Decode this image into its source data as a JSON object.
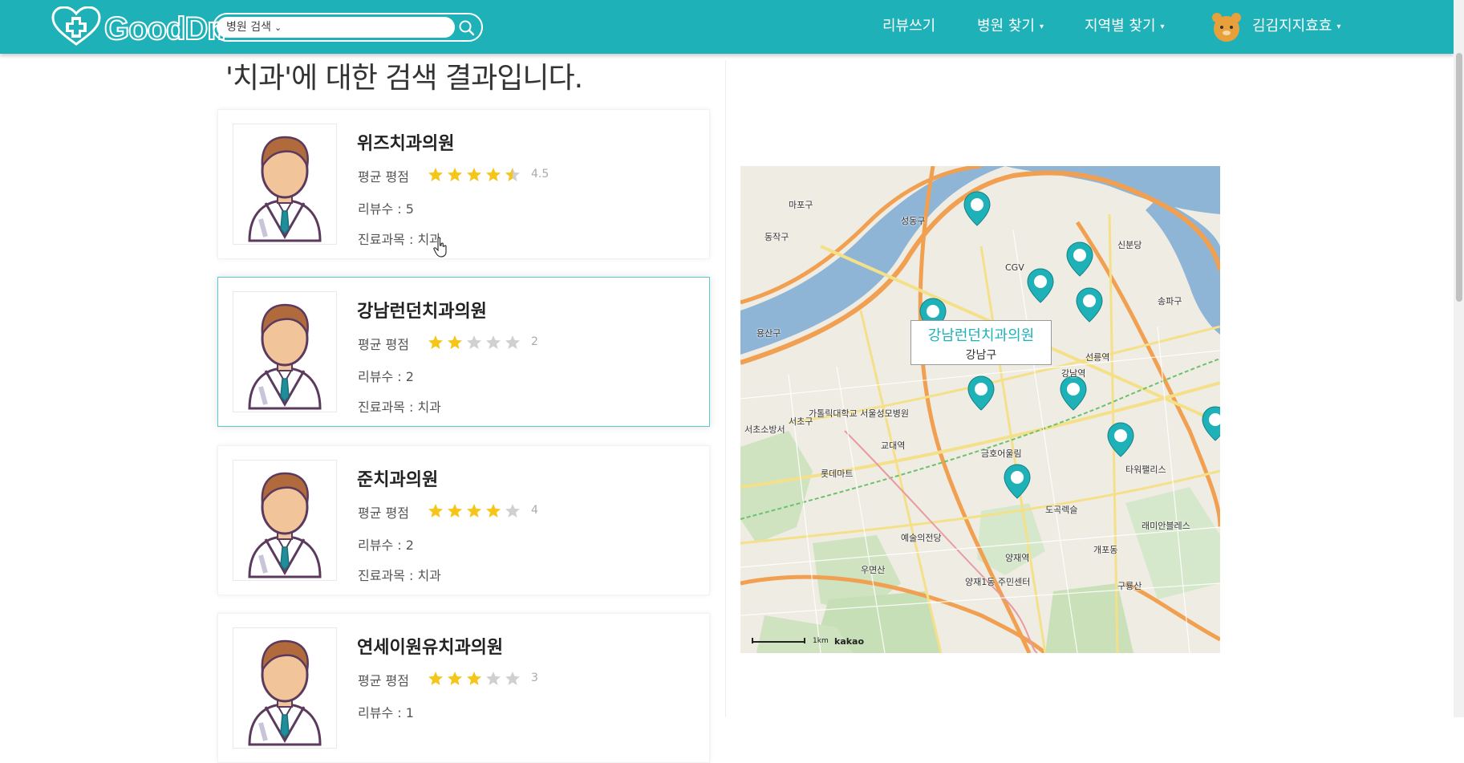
{
  "nav": {
    "logo_text": "GoodDr.",
    "search_select": "병원 검색",
    "write_review": "리뷰쓰기",
    "find_hospital": "병원 찾기",
    "find_region": "지역별 찾기",
    "user_name": "김김지지효효"
  },
  "heading": "'치과'에 대한 검색 결과입니다.",
  "labels": {
    "rating": "평균 평점",
    "reviews": "리뷰수 : ",
    "dept": "진료과목 : "
  },
  "hospitals": [
    {
      "name": "위즈치과의원",
      "rating": 4.5,
      "rating_text": "4.5",
      "reviews": "리뷰수 : 5",
      "dept": "진료과목 : 치과"
    },
    {
      "name": "강남런던치과의원",
      "rating": 2,
      "rating_text": "2",
      "reviews": "리뷰수 : 2",
      "dept": "진료과목 : 치과"
    },
    {
      "name": "준치과의원",
      "rating": 4,
      "rating_text": "4",
      "reviews": "리뷰수 : 2",
      "dept": "진료과목 : 치과"
    },
    {
      "name": "연세이원유치과의원",
      "rating": 3,
      "rating_text": "3",
      "reviews": "리뷰수 : 1",
      "dept": ""
    }
  ],
  "map": {
    "tooltip_title": "강남런던치과의원",
    "tooltip_sub": "강남구",
    "attribution": "kakao",
    "scale_label": "1km",
    "places": [
      "마포구",
      "성동구",
      "용산구",
      "서초구",
      "강남구",
      "송파구",
      "CGV",
      "동작구",
      "신분당",
      "강남역",
      "선릉역",
      "교대역",
      "예술의전당",
      "서초소방서",
      "우면산",
      "구룡산",
      "개포동",
      "양재역",
      "양재1동 주민센터",
      "도곡렉슬",
      "타워팰리스",
      "금호어울림",
      "래미안블레스",
      "가톨릭대학교 서울성모병원",
      "롯데마트"
    ]
  },
  "colors": {
    "brand": "#1fb1b8",
    "star_on": "#f5c518",
    "star_off": "#d0d0d0",
    "active_border": "#59c9c9"
  }
}
